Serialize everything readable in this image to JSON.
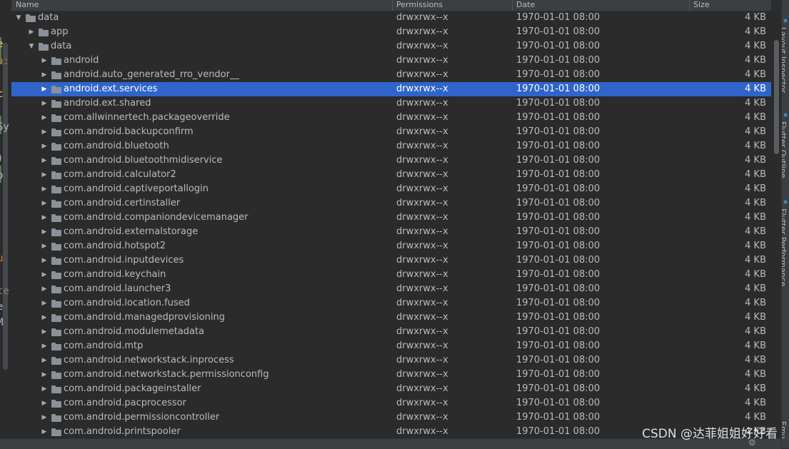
{
  "columns": {
    "name": "Name",
    "permissions": "Permissions",
    "date": "Date",
    "size": "Size"
  },
  "editor_fragments": [
    "e",
    "u:",
    "c",
    "Sy",
    ")",
    "o",
    "u",
    "te",
    "e",
    "M"
  ],
  "tree": [
    {
      "name": "data",
      "level": 0,
      "expanded": true,
      "permissions": "drwxrwx--x",
      "date": "1970-01-01 08:00",
      "size": "4 KB"
    },
    {
      "name": "app",
      "level": 1,
      "expanded": false,
      "permissions": "drwxrwx--x",
      "date": "1970-01-01 08:00",
      "size": "4 KB"
    },
    {
      "name": "data",
      "level": 1,
      "expanded": true,
      "permissions": "drwxrwx--x",
      "date": "1970-01-01 08:00",
      "size": "4 KB"
    },
    {
      "name": "android",
      "level": 2,
      "expanded": false,
      "permissions": "drwxrwx--x",
      "date": "1970-01-01 08:00",
      "size": "4 KB"
    },
    {
      "name": "android.auto_generated_rro_vendor__",
      "level": 2,
      "expanded": false,
      "permissions": "drwxrwx--x",
      "date": "1970-01-01 08:00",
      "size": "4 KB"
    },
    {
      "name": "android.ext.services",
      "level": 2,
      "expanded": false,
      "selected": true,
      "permissions": "drwxrwx--x",
      "date": "1970-01-01 08:00",
      "size": "4 KB"
    },
    {
      "name": "android.ext.shared",
      "level": 2,
      "expanded": false,
      "permissions": "drwxrwx--x",
      "date": "1970-01-01 08:00",
      "size": "4 KB"
    },
    {
      "name": "com.allwinnertech.packageoverride",
      "level": 2,
      "expanded": false,
      "permissions": "drwxrwx--x",
      "date": "1970-01-01 08:00",
      "size": "4 KB"
    },
    {
      "name": "com.android.backupconfirm",
      "level": 2,
      "expanded": false,
      "permissions": "drwxrwx--x",
      "date": "1970-01-01 08:00",
      "size": "4 KB"
    },
    {
      "name": "com.android.bluetooth",
      "level": 2,
      "expanded": false,
      "permissions": "drwxrwx--x",
      "date": "1970-01-01 08:00",
      "size": "4 KB"
    },
    {
      "name": "com.android.bluetoothmidiservice",
      "level": 2,
      "expanded": false,
      "permissions": "drwxrwx--x",
      "date": "1970-01-01 08:00",
      "size": "4 KB"
    },
    {
      "name": "com.android.calculator2",
      "level": 2,
      "expanded": false,
      "permissions": "drwxrwx--x",
      "date": "1970-01-01 08:00",
      "size": "4 KB"
    },
    {
      "name": "com.android.captiveportallogin",
      "level": 2,
      "expanded": false,
      "permissions": "drwxrwx--x",
      "date": "1970-01-01 08:00",
      "size": "4 KB"
    },
    {
      "name": "com.android.certinstaller",
      "level": 2,
      "expanded": false,
      "permissions": "drwxrwx--x",
      "date": "1970-01-01 08:00",
      "size": "4 KB"
    },
    {
      "name": "com.android.companiondevicemanager",
      "level": 2,
      "expanded": false,
      "permissions": "drwxrwx--x",
      "date": "1970-01-01 08:00",
      "size": "4 KB"
    },
    {
      "name": "com.android.externalstorage",
      "level": 2,
      "expanded": false,
      "permissions": "drwxrwx--x",
      "date": "1970-01-01 08:00",
      "size": "4 KB"
    },
    {
      "name": "com.android.hotspot2",
      "level": 2,
      "expanded": false,
      "permissions": "drwxrwx--x",
      "date": "1970-01-01 08:00",
      "size": "4 KB"
    },
    {
      "name": "com.android.inputdevices",
      "level": 2,
      "expanded": false,
      "permissions": "drwxrwx--x",
      "date": "1970-01-01 08:00",
      "size": "4 KB"
    },
    {
      "name": "com.android.keychain",
      "level": 2,
      "expanded": false,
      "permissions": "drwxrwx--x",
      "date": "1970-01-01 08:00",
      "size": "4 KB"
    },
    {
      "name": "com.android.launcher3",
      "level": 2,
      "expanded": false,
      "permissions": "drwxrwx--x",
      "date": "1970-01-01 08:00",
      "size": "4 KB"
    },
    {
      "name": "com.android.location.fused",
      "level": 2,
      "expanded": false,
      "permissions": "drwxrwx--x",
      "date": "1970-01-01 08:00",
      "size": "4 KB"
    },
    {
      "name": "com.android.managedprovisioning",
      "level": 2,
      "expanded": false,
      "permissions": "drwxrwx--x",
      "date": "1970-01-01 08:00",
      "size": "4 KB"
    },
    {
      "name": "com.android.modulemetadata",
      "level": 2,
      "expanded": false,
      "permissions": "drwxrwx--x",
      "date": "1970-01-01 08:00",
      "size": "4 KB"
    },
    {
      "name": "com.android.mtp",
      "level": 2,
      "expanded": false,
      "permissions": "drwxrwx--x",
      "date": "1970-01-01 08:00",
      "size": "4 KB"
    },
    {
      "name": "com.android.networkstack.inprocess",
      "level": 2,
      "expanded": false,
      "permissions": "drwxrwx--x",
      "date": "1970-01-01 08:00",
      "size": "4 KB"
    },
    {
      "name": "com.android.networkstack.permissionconfig",
      "level": 2,
      "expanded": false,
      "permissions": "drwxrwx--x",
      "date": "1970-01-01 08:00",
      "size": "4 KB"
    },
    {
      "name": "com.android.packageinstaller",
      "level": 2,
      "expanded": false,
      "permissions": "drwxrwx--x",
      "date": "1970-01-01 08:00",
      "size": "4 KB"
    },
    {
      "name": "com.android.pacprocessor",
      "level": 2,
      "expanded": false,
      "permissions": "drwxrwx--x",
      "date": "1970-01-01 08:00",
      "size": "4 KB"
    },
    {
      "name": "com.android.permissioncontroller",
      "level": 2,
      "expanded": false,
      "permissions": "drwxrwx--x",
      "date": "1970-01-01 08:00",
      "size": "4 KB"
    },
    {
      "name": "com.android.printspooler",
      "level": 2,
      "expanded": false,
      "permissions": "drwxrwx--x",
      "date": "1970-01-01 08:00",
      "size": "4 KB"
    }
  ],
  "tool_windows": [
    "Layout Inspector",
    "Flutter Outline",
    "Flutter Performance",
    "Emu"
  ],
  "watermark": "CSDN @达菲姐姐好好看",
  "colors": {
    "selection": "#2f65ca",
    "panel_bg": "#2b2b2b",
    "header_bg": "#3c3f41",
    "tool_icon": "#3592c4"
  },
  "icons": {
    "expanded": "triangle-down",
    "collapsed": "triangle-right",
    "folder": "folder-icon",
    "settings": "gear-icon"
  }
}
